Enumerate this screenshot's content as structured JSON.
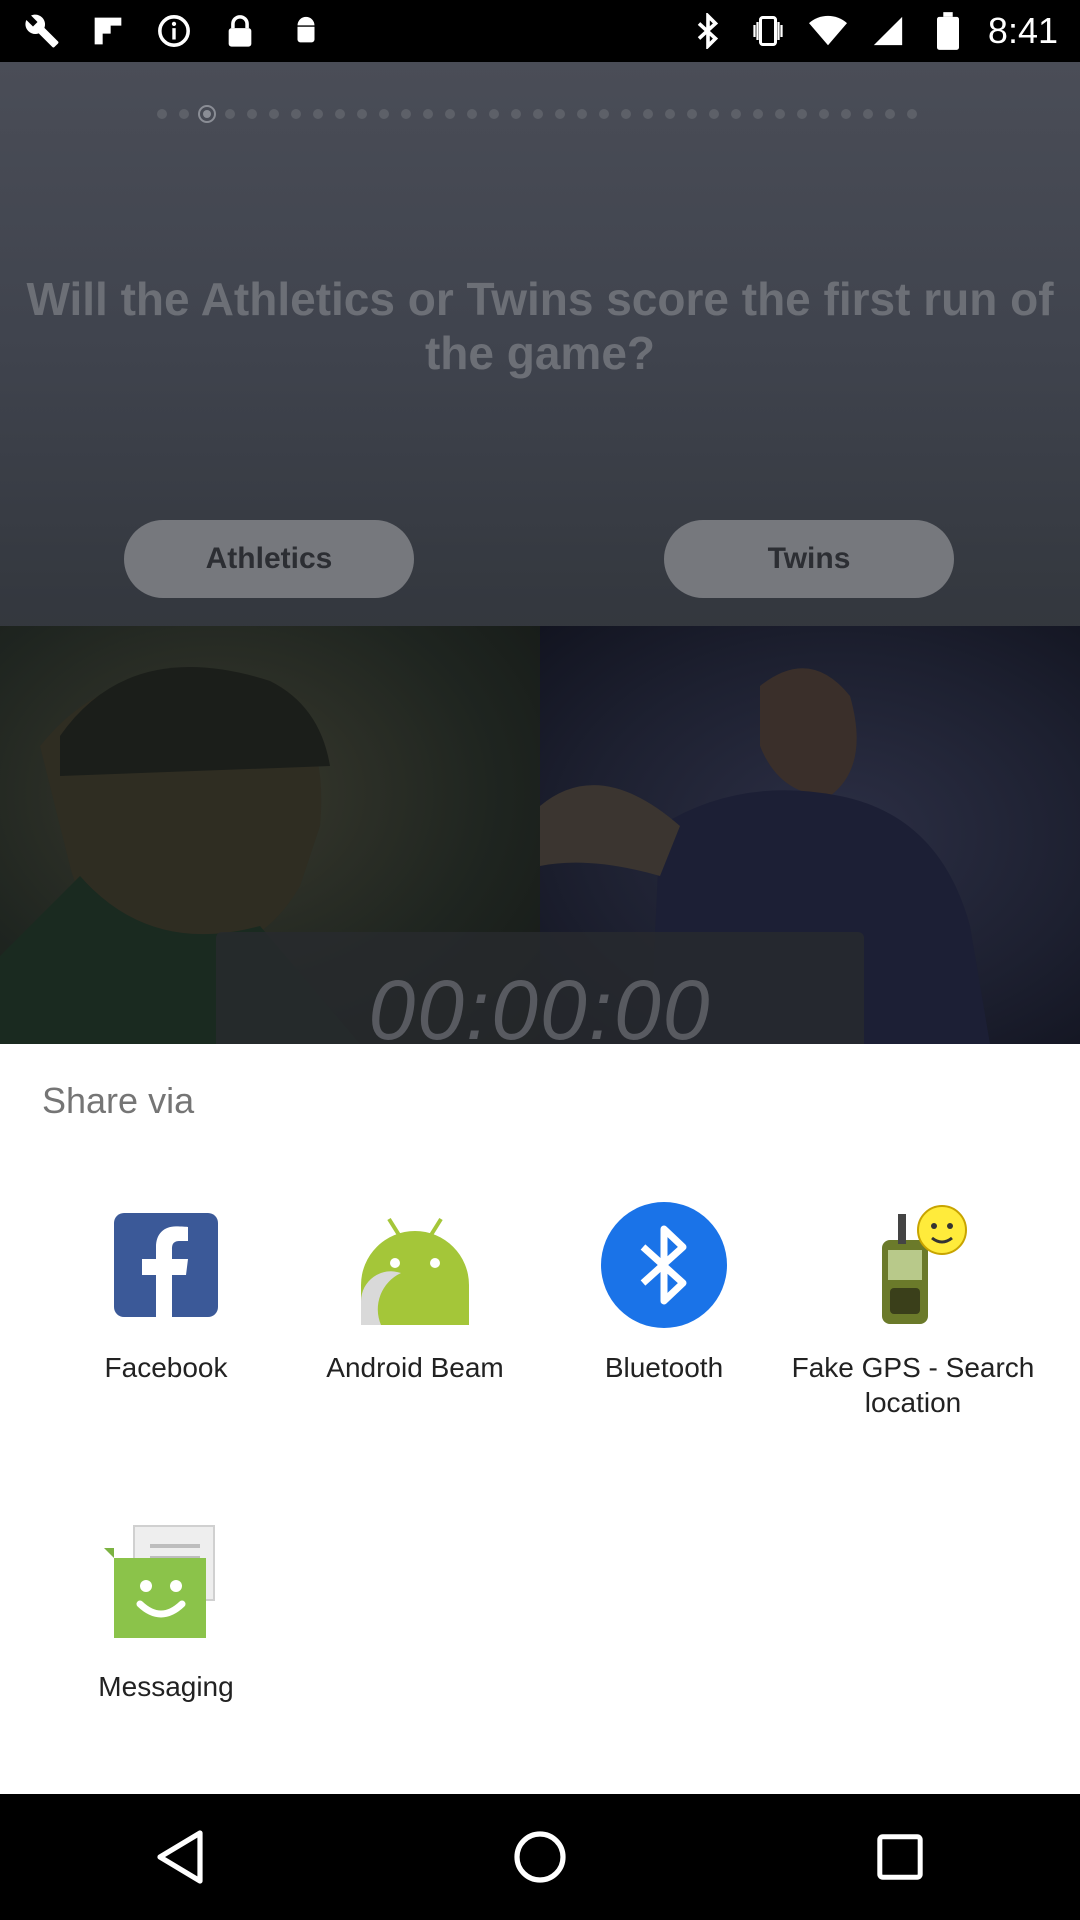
{
  "status_bar": {
    "time": "8:41",
    "left_icons": [
      "wrench-icon",
      "flipboard-icon",
      "info-icon",
      "lock-icon",
      "android-icon"
    ],
    "right_icons": [
      "bluetooth-icon",
      "vibrate-icon",
      "wifi-icon",
      "signal-icon",
      "battery-icon"
    ]
  },
  "background_app": {
    "question": "Will the Athletics or Twins score the first run of the game?",
    "choice_left": "Athletics",
    "choice_right": "Twins",
    "timer": "00:00:00"
  },
  "share_sheet": {
    "title": "Share via",
    "apps": [
      {
        "label": "Facebook",
        "icon": "facebook-icon"
      },
      {
        "label": "Android Beam",
        "icon": "android-beam-icon"
      },
      {
        "label": "Bluetooth",
        "icon": "bluetooth-icon"
      },
      {
        "label": "Fake GPS - Search location",
        "icon": "fake-gps-icon"
      },
      {
        "label": "Messaging",
        "icon": "messaging-icon"
      }
    ]
  },
  "nav_bar": {
    "icons": [
      "back-icon",
      "home-icon",
      "recents-icon"
    ]
  },
  "colors": {
    "facebook_blue": "#3b5998",
    "android_green": "#a4c639",
    "bluetooth_blue": "#1a73e8",
    "messaging_green": "#8bc34a",
    "sheet_bg": "#ffffff"
  }
}
